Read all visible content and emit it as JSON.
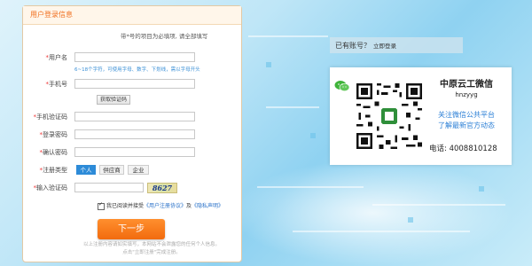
{
  "panel": {
    "title": "用户登录信息",
    "notice_mark": "带*",
    "notice": "号的项目为必填项, 请全部填写"
  },
  "form": {
    "username_label": "用户名",
    "username_hint": "6~18个字符，可使用字母、数字、下划线，需以字母开头",
    "phone_label": "手机号",
    "sms_button": "获取验证码",
    "sms_code_label": "手机验证码",
    "password_label": "登录密码",
    "confirm_password_label": "确认密码",
    "register_type_label": "注册类型",
    "register_types": [
      "个人",
      "供应商",
      "企业"
    ],
    "selected_type": "个人",
    "captcha_label": "输入验证码",
    "captcha_text": "8627",
    "agree_text": "我已阅读并接受",
    "agree_link1": "《用户注册协议》",
    "agree_and": "及",
    "agree_link2": "《隐私声明》",
    "next_button": "下一步",
    "footer_line1": "以上注册内容请如实填写，本网站不会泄露您的任何个人信息。",
    "footer_line2": "点击\"立即注册\"完成注册。"
  },
  "login_prompt": {
    "text": "已有账号？",
    "link": "立即登录"
  },
  "wechat_card": {
    "icon": "wechat-icon",
    "title": "中原云工微信",
    "account_id": "hnzyyg",
    "desc_line1": "关注微信公共平台",
    "desc_line2": "了解最新官方动态",
    "phone_label": "电话:",
    "phone_number": "4008810128"
  },
  "colors": {
    "accent_orange": "#f26b0e",
    "link_blue": "#2a72c9",
    "selected_blue": "#2d8bd8"
  }
}
